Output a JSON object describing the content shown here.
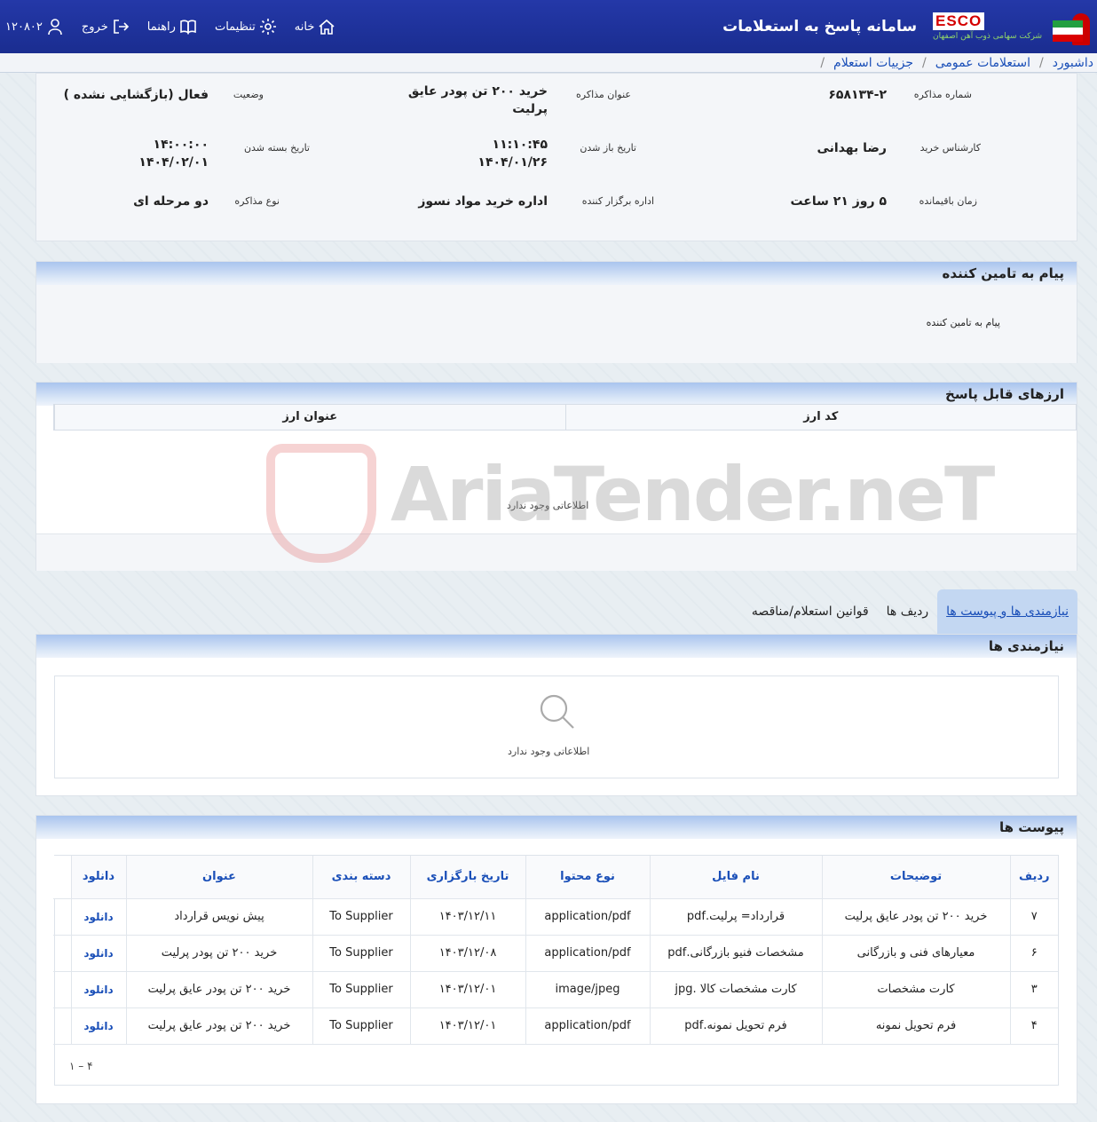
{
  "header": {
    "app_title": "سامانه پاسخ به استعلامات",
    "brand_name": "ESCO",
    "brand_sub": "شرکت سهامی ذوب آهن اصفهان",
    "nav": {
      "home": "خانه",
      "settings": "تنظیمات",
      "guide": "راهنما",
      "logout": "خروج",
      "user_id": "۱۲۰۸۰۲"
    }
  },
  "breadcrumb": [
    "داشبورد",
    "استعلامات عمومی",
    "جزییات استعلام"
  ],
  "info": {
    "negotiation_number_label": "شماره مذاکره",
    "negotiation_number": "۶۵۸۱۳۴-۲",
    "title_label": "عنوان مذاکره",
    "title": "خرید ۲۰۰ تن پودر عایق پرلیت",
    "status_label": "وضعیت",
    "status": "فعال (بازگشایی نشده )",
    "expert_label": "کارشناس خرید",
    "expert": "رضا بهدانی",
    "open_date_label": "تاریخ باز شدن",
    "open_time": "۱۱:۱۰:۴۵",
    "open_date": "۱۴۰۴/۰۱/۲۶",
    "close_date_label": "تاریخ بسته شدن",
    "close_time": "۱۴:۰۰:۰۰",
    "close_date": "۱۴۰۴/۰۲/۰۱",
    "remaining_label": "زمان باقیمانده",
    "remaining": "۵ روز ۲۱ ساعت",
    "organizer_label": "اداره برگزار کننده",
    "organizer": "اداره خرید مواد نسوز",
    "type_label": "نوع مذاکره",
    "type": "دو مرحله ای"
  },
  "supplier_message": {
    "title": "پیام به تامین کننده",
    "text": "پیام به تامین کننده"
  },
  "currencies": {
    "title": "ارزهای قابل پاسخ",
    "col_code": "کد ارز",
    "col_name": "عنوان ارز",
    "empty": "اطلاعاتی وجود ندارد"
  },
  "watermark": "AriaTender.neT",
  "tabs": [
    "نیازمندی ها و پیوست ها",
    "ردیف ها",
    "قوانین استعلام/مناقصه"
  ],
  "needs": {
    "title": "نیازمندی ها",
    "empty": "اطلاعاتی وجود ندارد"
  },
  "attachments": {
    "title": "پیوست ها",
    "columns": [
      "ردیف",
      "توضیحات",
      "نام فایل",
      "نوع محتوا",
      "تاریخ بارگزاری",
      "دسته بندی",
      "عنوان",
      "دانلود"
    ],
    "rows": [
      {
        "row": "۷",
        "desc": "خرید ۲۰۰ تن پودر عایق پرلیت",
        "file": "قرارداد= پرلیت.pdf",
        "type": "application/pdf",
        "date": "۱۴۰۳/۱۲/۱۱",
        "category": "To Supplier",
        "title": "پیش نویس قرارداد",
        "download": "دانلود"
      },
      {
        "row": "۶",
        "desc": "معیارهای فنی و بازرگانی",
        "file": "مشخصات فنیو بازرگانی.pdf",
        "type": "application/pdf",
        "date": "۱۴۰۳/۱۲/۰۸",
        "category": "To Supplier",
        "title": "خرید ۲۰۰ تن پودر پرلیت",
        "download": "دانلود"
      },
      {
        "row": "۳",
        "desc": "کارت مشخصات",
        "file": "کارت مشخصات کالا .jpg",
        "type": "image/jpeg",
        "date": "۱۴۰۳/۱۲/۰۱",
        "category": "To Supplier",
        "title": "خرید ۲۰۰ تن پودر عایق پرلیت",
        "download": "دانلود"
      },
      {
        "row": "۴",
        "desc": "فرم تحویل نمونه",
        "file": "فرم تحویل نمونه.pdf",
        "type": "application/pdf",
        "date": "۱۴۰۳/۱۲/۰۱",
        "category": "To Supplier",
        "title": "خرید ۲۰۰ تن پودر عایق پرلیت",
        "download": "دانلود"
      }
    ],
    "pager": "۱ – ۴"
  }
}
